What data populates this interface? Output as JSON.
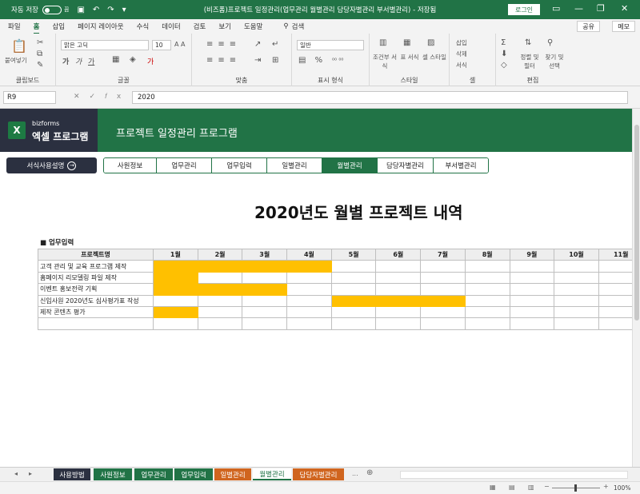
{
  "titlebar": {
    "autosave_label": "자동 저장",
    "autosave_state": "끔",
    "title": "(비즈폼)프로젝트 일정관리(업무관리 월별관리 담당자별관리 부서별관리) - 저장됨",
    "login": "로그인"
  },
  "ribbon_tabs": [
    "파일",
    "홈",
    "삽입",
    "페이지 레이아웃",
    "수식",
    "데이터",
    "검토",
    "보기",
    "도움말"
  ],
  "ribbon_active_tab": "홈",
  "ribbon_search": "검색",
  "share": "공유",
  "memo": "메모",
  "ribbon": {
    "clipboard": {
      "paste": "붙여넣기",
      "label": "클립보드"
    },
    "font": {
      "name": "맑은 고딕",
      "size": "10",
      "label": "글꼴"
    },
    "align": {
      "label": "맞춤"
    },
    "number": {
      "format": "일반",
      "label": "표시 형식"
    },
    "style": {
      "cond": "조건부 서식",
      "table": "표 서식",
      "cell": "셀 스타일",
      "label": "스타일"
    },
    "cells": {
      "insert": "삽입",
      "delete": "삭제",
      "format": "서식",
      "label": "셀"
    },
    "edit": {
      "sort": "정렬 및 필터",
      "find": "찾기 및 선택",
      "label": "편집"
    }
  },
  "formula": {
    "cell": "R9",
    "value": "2020"
  },
  "banner": {
    "brand_small": "bizforms",
    "brand_big": "엑셀 프로그램",
    "title": "프로젝트 일정관리 프로그램"
  },
  "guide_button": "서식사용설명",
  "nav_tabs": [
    "사원정보",
    "업무관리",
    "업무입력",
    "일별관리",
    "월별관리",
    "담당자별관리",
    "부서별관리"
  ],
  "nav_active": "월별관리",
  "page_title": "2020년도 월별 프로젝트 내역",
  "section_label": "■ 업무입력",
  "table": {
    "header_project": "프로젝트명",
    "months": [
      "1월",
      "2월",
      "3월",
      "4월",
      "5월",
      "6월",
      "7월",
      "8월",
      "9월",
      "10월",
      "11월"
    ],
    "rows": [
      {
        "name": "고객 관리 및 교육 프로그램 제작",
        "filled": [
          1,
          2,
          3,
          4
        ]
      },
      {
        "name": "홈페이지 리모델링 파일 제작",
        "filled": [
          1
        ]
      },
      {
        "name": "이벤트 홍보전략 기획",
        "filled": [
          1,
          2,
          3
        ]
      },
      {
        "name": "신입사원 2020년도 심사평가표 작성",
        "filled": [
          5,
          6,
          7
        ]
      },
      {
        "name": "제작 콘텐츠 평가",
        "filled": [
          1
        ]
      },
      {
        "name": "",
        "filled": []
      }
    ]
  },
  "sheet_tabs": [
    {
      "label": "사용방법",
      "color": "#2b3040"
    },
    {
      "label": "사원정보",
      "color": "#217346"
    },
    {
      "label": "업무관리",
      "color": "#217346"
    },
    {
      "label": "업무입력",
      "color": "#217346"
    },
    {
      "label": "일별관리",
      "color": "#d0651f"
    },
    {
      "label": "월별관리",
      "color": "#ffffff"
    },
    {
      "label": "담당자별관리",
      "color": "#d0651f"
    }
  ],
  "sheet_tabs_more": "...",
  "zoom": "100%",
  "fill_color": "#ffc000"
}
